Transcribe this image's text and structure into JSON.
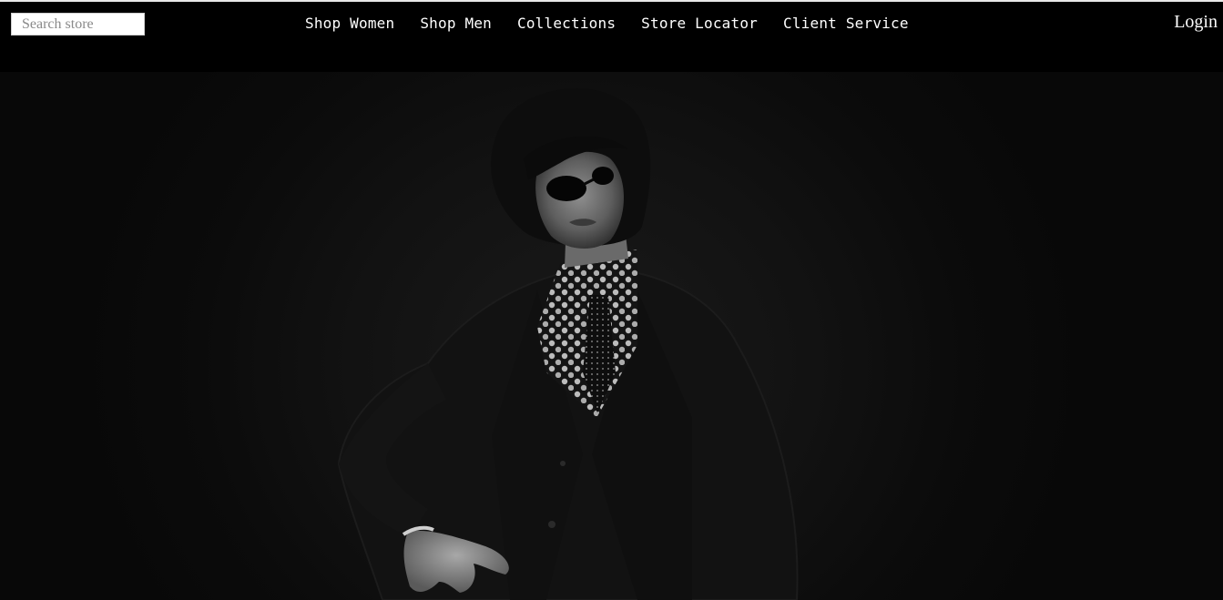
{
  "search": {
    "placeholder": "Search store",
    "value": ""
  },
  "nav": {
    "items": [
      {
        "label": "Shop Women"
      },
      {
        "label": "Shop Men"
      },
      {
        "label": "Collections"
      },
      {
        "label": "Store Locator"
      },
      {
        "label": "Client Service"
      }
    ]
  },
  "account": {
    "login_label": "Login"
  },
  "colors": {
    "header_bg": "#000000",
    "nav_text": "#ffffff",
    "hero_bg": "#111111"
  },
  "hero": {
    "image_subject": "hero-photo-model"
  }
}
